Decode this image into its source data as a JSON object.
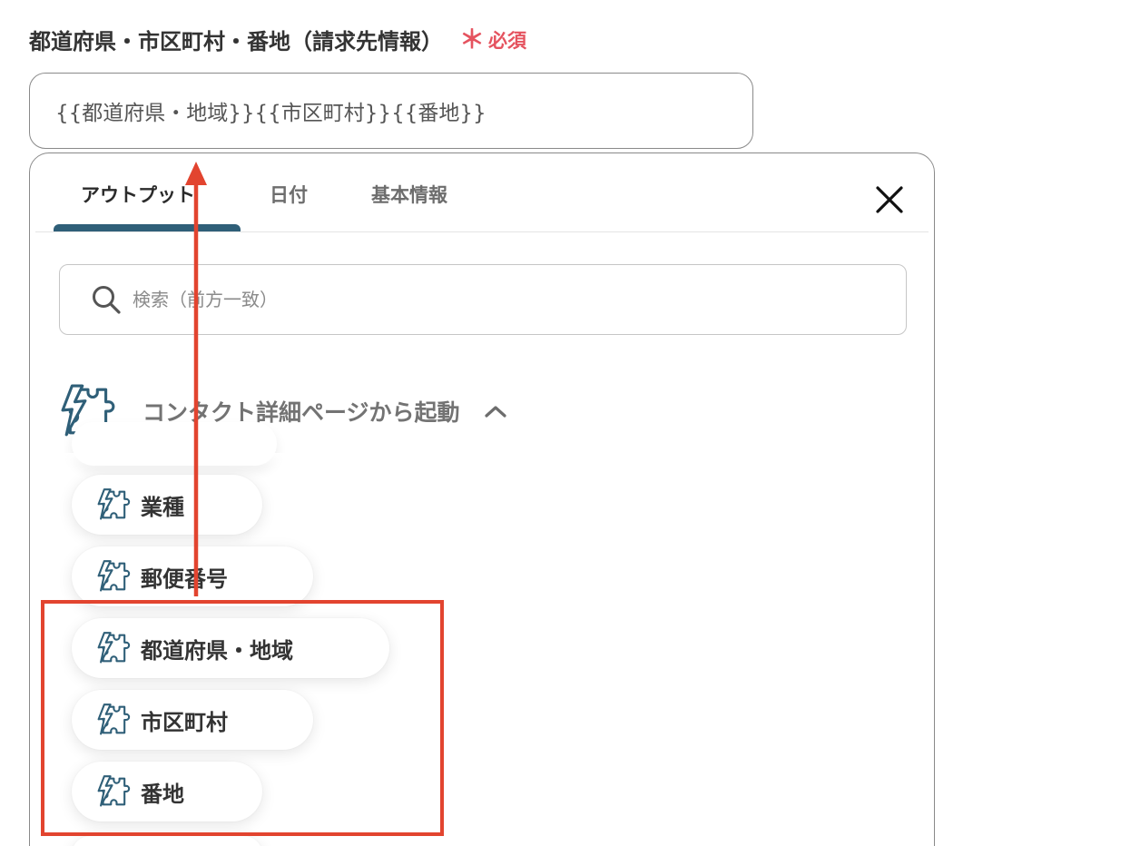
{
  "field": {
    "label": "都道府県・市区町村・番地（請求先情報）",
    "required_mark": "＊",
    "required_text": "必須",
    "value": "{{都道府県・地域}}{{市区町村}}{{番地}}"
  },
  "panel": {
    "tabs": [
      {
        "label": "アウトプット",
        "active": true
      },
      {
        "label": "日付",
        "active": false
      },
      {
        "label": "基本情報",
        "active": false
      }
    ],
    "search": {
      "placeholder": "検索（前方一致）",
      "value": ""
    },
    "section": {
      "title": "コンタクト詳細ページから起動",
      "expanded": true,
      "icon": "puzzle-bolt-icon"
    },
    "items": [
      {
        "label": "業種"
      },
      {
        "label": "郵便番号"
      },
      {
        "label": "都道府県・地域"
      },
      {
        "label": "市区町村"
      },
      {
        "label": "番地"
      }
    ]
  },
  "colors": {
    "accent": "#2f5f78",
    "required": "#e5535f",
    "annotation": "#e2442f"
  }
}
